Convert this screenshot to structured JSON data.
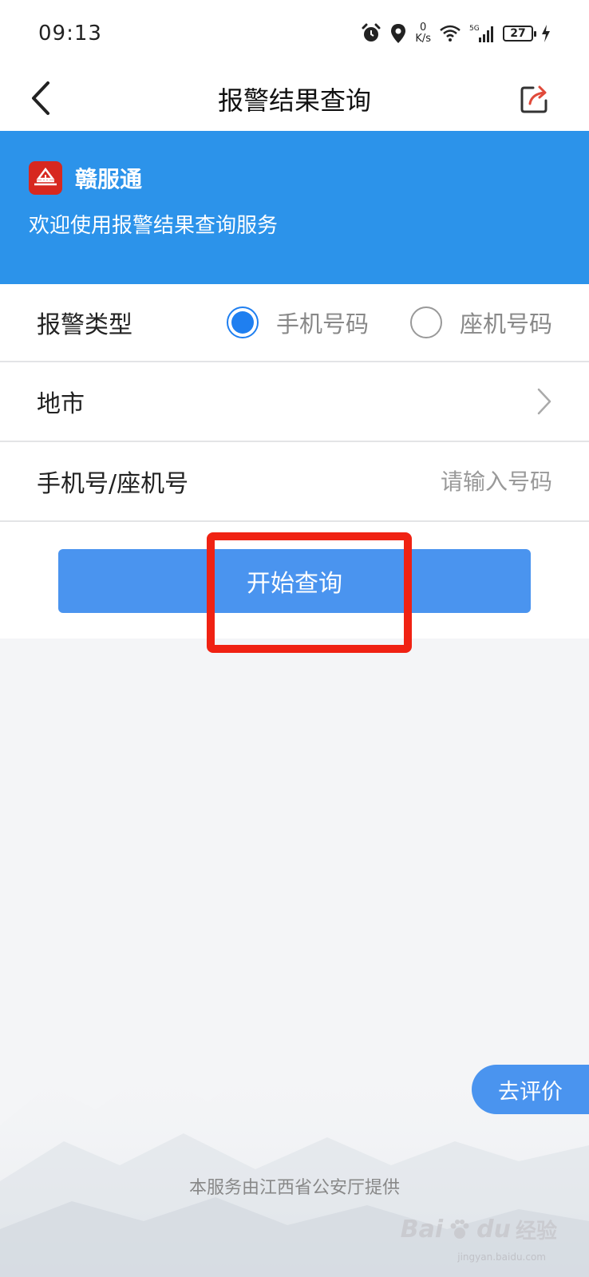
{
  "status_bar": {
    "time": "09:13",
    "net_speed_value": "0",
    "net_speed_unit": "K/s",
    "network": "5G",
    "battery": "27",
    "icons": [
      "alarm-icon",
      "location-icon",
      "wifi-icon",
      "signal-icon",
      "battery-icon",
      "charging-icon"
    ]
  },
  "nav": {
    "title": "报警结果查询",
    "back_icon": "chevron-left-icon",
    "share_icon": "share-icon"
  },
  "banner": {
    "app_name": "赣服通",
    "welcome": "欢迎使用报警结果查询服务",
    "color": "#2c93ea"
  },
  "form": {
    "type_label": "报警类型",
    "options": [
      {
        "label": "手机号码",
        "checked": true
      },
      {
        "label": "座机号码",
        "checked": false
      }
    ],
    "city_label": "地市",
    "phone_label": "手机号/座机号",
    "phone_placeholder": "请输入号码",
    "phone_value": ""
  },
  "query_button": {
    "label": "开始查询",
    "color": "#4a94ef"
  },
  "annotation": {
    "color": "#f02213"
  },
  "rate_button": {
    "label": "去评价"
  },
  "footer": {
    "text": "本服务由江西省公安厅提供"
  },
  "watermark": {
    "brand": "Bai",
    "brand_suffix": "du",
    "brand_cn": "经验",
    "url": "jingyan.baidu.com"
  }
}
